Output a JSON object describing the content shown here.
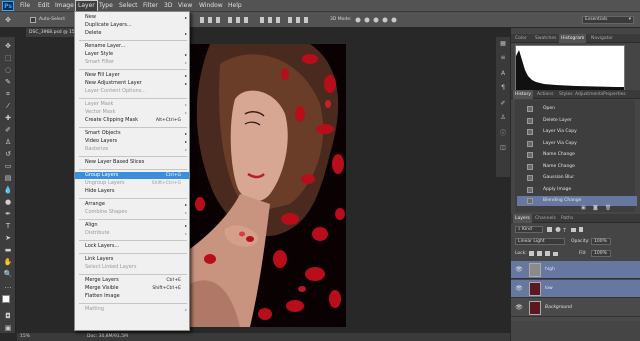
{
  "app": {
    "logo": "Ps"
  },
  "menubar": {
    "items": [
      "File",
      "Edit",
      "Image",
      "Layer",
      "Type",
      "Select",
      "Filter",
      "3D",
      "View",
      "Window",
      "Help"
    ],
    "active": "Layer"
  },
  "options": {
    "auto_select_label": "Auto-Select",
    "mode_3d": "3D Mode:",
    "workspace": "Essentials"
  },
  "document": {
    "tab_title": "DSC_3968.psd @ 15%"
  },
  "layer_menu": {
    "items": [
      {
        "label": "New",
        "arrow": true
      },
      {
        "label": "Duplicate Layers..."
      },
      {
        "label": "Delete",
        "arrow": true
      },
      {
        "label": "Rename Layer..."
      },
      {
        "label": "Layer Style",
        "arrow": true
      },
      {
        "label": "Smart Filter",
        "arrow": true,
        "disabled": true
      },
      {
        "label": "New Fill Layer",
        "arrow": true
      },
      {
        "label": "New Adjustment Layer",
        "arrow": true
      },
      {
        "label": "Layer Content Options...",
        "disabled": true
      },
      {
        "label": "Layer Mask",
        "arrow": true,
        "disabled": true
      },
      {
        "label": "Vector Mask",
        "arrow": true,
        "disabled": true
      },
      {
        "label": "Create Clipping Mask",
        "shortcut": "Alt+Ctrl+G"
      },
      {
        "label": "Smart Objects",
        "arrow": true
      },
      {
        "label": "Video Layers",
        "arrow": true
      },
      {
        "label": "Rasterize",
        "arrow": true,
        "disabled": true
      },
      {
        "label": "New Layer Based Slices"
      },
      {
        "label": "Group Layers",
        "shortcut": "Ctrl+G",
        "highlight": true
      },
      {
        "label": "Ungroup Layers",
        "shortcut": "Shift+Ctrl+G",
        "disabled": true
      },
      {
        "label": "Hide Layers"
      },
      {
        "label": "Arrange",
        "arrow": true
      },
      {
        "label": "Combine Shapes",
        "arrow": true,
        "disabled": true
      },
      {
        "label": "Align",
        "arrow": true
      },
      {
        "label": "Distribute",
        "arrow": true,
        "disabled": true
      },
      {
        "label": "Lock Layers..."
      },
      {
        "label": "Link Layers"
      },
      {
        "label": "Select Linked Layers",
        "disabled": true
      },
      {
        "label": "Merge Layers",
        "shortcut": "Ctrl+E"
      },
      {
        "label": "Merge Visible",
        "shortcut": "Shift+Ctrl+E"
      },
      {
        "label": "Flatten Image"
      },
      {
        "label": "Matting",
        "arrow": true,
        "disabled": true
      }
    ]
  },
  "panels": {
    "top_tabs": [
      "Color",
      "Swatches",
      "Histogram",
      "Navigator"
    ],
    "top_active": "Histogram",
    "history_tabs": [
      "History",
      "Actions",
      "Styles",
      "Adjustments",
      "Properties"
    ],
    "history_active": "History",
    "history_items": [
      "Open",
      "Delete Layer",
      "Layer Via Copy",
      "Layer Via Copy",
      "Name Change",
      "Name Change",
      "Gaussian Blur",
      "Apply Image",
      "Blending Change"
    ],
    "history_selected": "Blending Change",
    "layers_tabs": [
      "Layers",
      "Channels",
      "Paths"
    ],
    "layers_active": "Layers",
    "kind_filter": "Kind",
    "blend_mode": "Linear Light",
    "opacity_label": "Opacity:",
    "opacity_value": "100%",
    "lock_label": "Lock:",
    "fill_label": "Fill:",
    "fill_value": "100%",
    "layers": [
      {
        "name": "high",
        "selected": true
      },
      {
        "name": "low",
        "selected": true
      },
      {
        "name": "Background",
        "selected": false
      }
    ]
  },
  "status": {
    "zoom": "15%",
    "doc_info": "Doc: 30,8M/91,5M"
  },
  "colors": {
    "highlight": "#3b8edb",
    "selected_row": "#6678a0"
  }
}
